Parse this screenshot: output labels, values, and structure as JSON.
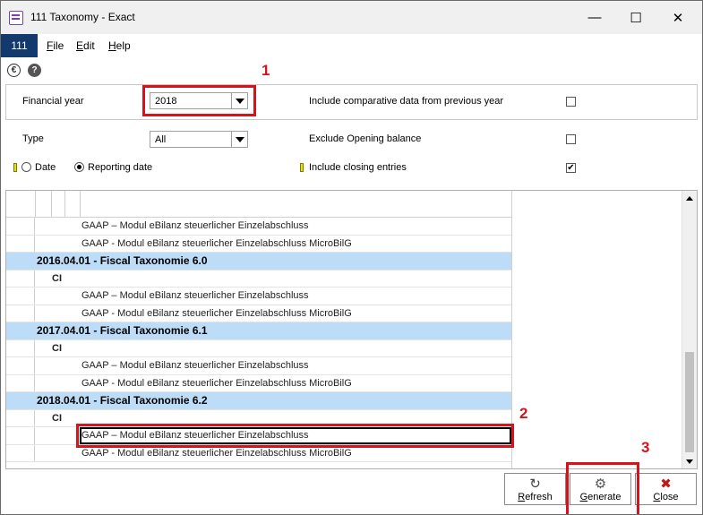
{
  "window": {
    "title": "111 Taxonomy - Exact",
    "min_glyph": "—",
    "max_glyph": "☐",
    "close_glyph": "✕"
  },
  "menu": {
    "badge": "111",
    "items": [
      {
        "first": "F",
        "rest": "ile"
      },
      {
        "first": "E",
        "rest": "dit"
      },
      {
        "first": "H",
        "rest": "elp"
      }
    ]
  },
  "toolbar": {
    "euro_glyph": "€",
    "help_glyph": "?"
  },
  "filters": {
    "financial_year_label": "Financial year",
    "financial_year_value": "2018",
    "type_label": "Type",
    "type_value": "All",
    "date_label": "Date",
    "reporting_date_label": "Reporting date",
    "date_mode": "Reporting date",
    "comparative_label": "Include comparative data from previous year",
    "comparative_checked": false,
    "exclude_opening_label": "Exclude Opening balance",
    "exclude_opening_checked": false,
    "closing_entries_label": "Include closing entries",
    "closing_entries_checked": true,
    "check_glyph": "✔"
  },
  "annotations": {
    "one": "1",
    "two": "2",
    "three": "3"
  },
  "grid": {
    "rows": [
      {
        "kind": "item",
        "text": "GAAP – Modul eBilanz steuerlicher Einzelabschluss"
      },
      {
        "kind": "item",
        "text": "GAAP - Modul eBilanz steuerlicher Einzelabschluss MicroBilG"
      },
      {
        "kind": "group",
        "text": "2016.04.01 - Fiscal Taxonomie 6.0"
      },
      {
        "kind": "sub",
        "text": "CI"
      },
      {
        "kind": "item",
        "text": "GAAP – Modul eBilanz steuerlicher Einzelabschluss"
      },
      {
        "kind": "item",
        "text": "GAAP - Modul eBilanz steuerlicher Einzelabschluss MicroBilG"
      },
      {
        "kind": "group",
        "text": "2017.04.01 - Fiscal Taxonomie 6.1"
      },
      {
        "kind": "sub",
        "text": "CI"
      },
      {
        "kind": "item",
        "text": "GAAP – Modul eBilanz steuerlicher Einzelabschluss"
      },
      {
        "kind": "item",
        "text": "GAAP - Modul eBilanz steuerlicher Einzelabschluss MicroBilG"
      },
      {
        "kind": "group",
        "text": "2018.04.01 - Fiscal Taxonomie 6.2"
      },
      {
        "kind": "sub",
        "text": "CI"
      },
      {
        "kind": "item",
        "text": "GAAP – Modul eBilanz steuerlicher Einzelabschluss",
        "selected": true
      },
      {
        "kind": "item",
        "text": "GAAP - Modul eBilanz steuerlicher Einzelabschluss MicroBilG"
      }
    ]
  },
  "buttons": {
    "refresh": {
      "first": "R",
      "rest": "efresh",
      "glyph": "↻"
    },
    "generate": {
      "first": "G",
      "rest": "enerate",
      "glyph": "⚙"
    },
    "close": {
      "first": "C",
      "rest": "lose",
      "glyph": "✖"
    }
  },
  "colors": {
    "accent_red": "#d9111b",
    "group_row": "#bcdcf8",
    "menu_badge": "#123a6c"
  }
}
